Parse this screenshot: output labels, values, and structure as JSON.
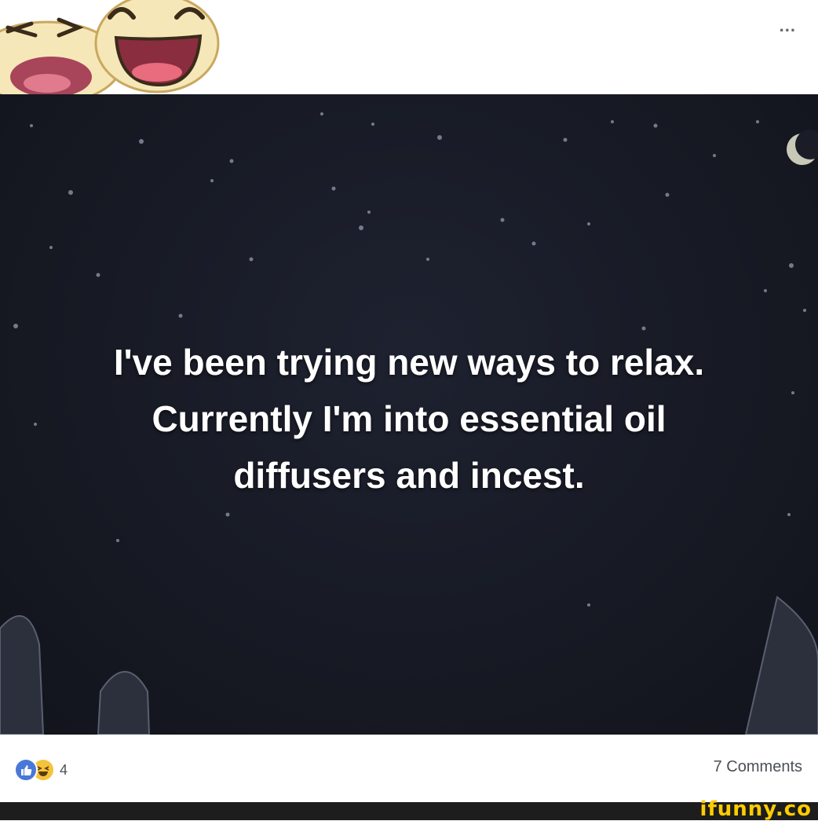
{
  "post": {
    "quote_lines": [
      "I've been trying new ways to relax.",
      "Currently I'm into essential oil",
      "diffusers and incest."
    ],
    "reaction_count": "4",
    "comments_label": "7 Comments",
    "more_label": "..."
  },
  "watermark": {
    "text": "ifunny.co"
  },
  "icons": {
    "more": "more-options-icon",
    "like": "like-reaction-icon",
    "haha": "haha-reaction-icon",
    "sticker": "laughing-emoji-sticker",
    "moon": "crescent-moon-icon"
  },
  "colors": {
    "background_night": "#171a24",
    "like_blue": "#4a78d8",
    "haha_yellow": "#f5c33b",
    "watermark_yellow": "#ffcc00"
  }
}
